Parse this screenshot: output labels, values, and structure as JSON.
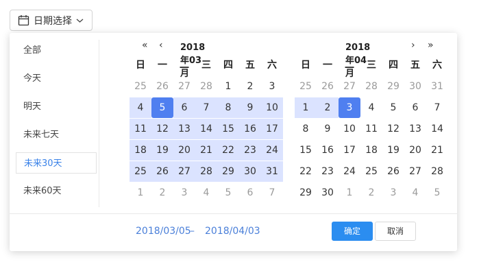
{
  "trigger": {
    "label": "日期选择",
    "icon": "calendar-icon",
    "caret": "chevron-down-icon"
  },
  "presets": [
    {
      "label": "全部",
      "active": false
    },
    {
      "label": "今天",
      "active": false
    },
    {
      "label": "明天",
      "active": false
    },
    {
      "label": "未来七天",
      "active": false
    },
    {
      "label": "未来30天",
      "active": true
    },
    {
      "label": "未来60天",
      "active": false
    }
  ],
  "weekdays": [
    "日",
    "一",
    "二",
    "三",
    "四",
    "五",
    "六"
  ],
  "calendars": [
    {
      "title": "2018年03月",
      "days": [
        [
          "25",
          "26",
          "27",
          "28",
          "1",
          "2",
          "3"
        ],
        [
          "4",
          "5",
          "6",
          "7",
          "8",
          "9",
          "10"
        ],
        [
          "11",
          "12",
          "13",
          "14",
          "15",
          "16",
          "17"
        ],
        [
          "18",
          "19",
          "20",
          "21",
          "22",
          "23",
          "24"
        ],
        [
          "25",
          "26",
          "27",
          "28",
          "29",
          "30",
          "31"
        ],
        [
          "1",
          "2",
          "3",
          "4",
          "5",
          "6",
          "7"
        ]
      ],
      "outside": [
        [
          0,
          0
        ],
        [
          0,
          1
        ],
        [
          0,
          2
        ],
        [
          0,
          3
        ],
        [
          5,
          0
        ],
        [
          5,
          1
        ],
        [
          5,
          2
        ],
        [
          5,
          3
        ],
        [
          5,
          4
        ],
        [
          5,
          5
        ],
        [
          5,
          6
        ]
      ],
      "selected": [
        [
          1,
          1
        ]
      ],
      "in_range": [
        [
          1,
          0
        ],
        [
          1,
          2
        ],
        [
          1,
          3
        ],
        [
          1,
          4
        ],
        [
          1,
          5
        ],
        [
          1,
          6
        ],
        [
          2,
          0
        ],
        [
          2,
          1
        ],
        [
          2,
          2
        ],
        [
          2,
          3
        ],
        [
          2,
          4
        ],
        [
          2,
          5
        ],
        [
          2,
          6
        ],
        [
          3,
          0
        ],
        [
          3,
          1
        ],
        [
          3,
          2
        ],
        [
          3,
          3
        ],
        [
          3,
          4
        ],
        [
          3,
          5
        ],
        [
          3,
          6
        ],
        [
          4,
          0
        ],
        [
          4,
          1
        ],
        [
          4,
          2
        ],
        [
          4,
          3
        ],
        [
          4,
          4
        ],
        [
          4,
          5
        ],
        [
          4,
          6
        ]
      ]
    },
    {
      "title": "2018年04月",
      "days": [
        [
          "25",
          "26",
          "27",
          "28",
          "29",
          "30",
          "31"
        ],
        [
          "1",
          "2",
          "3",
          "4",
          "5",
          "6",
          "7"
        ],
        [
          "8",
          "9",
          "10",
          "11",
          "12",
          "13",
          "14"
        ],
        [
          "15",
          "16",
          "17",
          "18",
          "19",
          "20",
          "21"
        ],
        [
          "22",
          "23",
          "24",
          "25",
          "26",
          "27",
          "28"
        ],
        [
          "29",
          "30",
          "1",
          "2",
          "3",
          "4",
          "5"
        ]
      ],
      "outside": [
        [
          0,
          0
        ],
        [
          0,
          1
        ],
        [
          0,
          2
        ],
        [
          0,
          3
        ],
        [
          0,
          4
        ],
        [
          0,
          5
        ],
        [
          0,
          6
        ],
        [
          5,
          2
        ],
        [
          5,
          3
        ],
        [
          5,
          4
        ],
        [
          5,
          5
        ],
        [
          5,
          6
        ]
      ],
      "selected": [
        [
          1,
          2
        ]
      ],
      "in_range": [
        [
          1,
          0
        ],
        [
          1,
          1
        ]
      ]
    }
  ],
  "range": {
    "start": "2018/03/05",
    "separator": "–",
    "end": "2018/04/03"
  },
  "buttons": {
    "ok": "确定",
    "cancel": "取消"
  },
  "colors": {
    "accent": "#4f7ff0",
    "range_bg": "#dbe3ff",
    "link": "#4a7fd9",
    "button": "#2b8df0"
  }
}
